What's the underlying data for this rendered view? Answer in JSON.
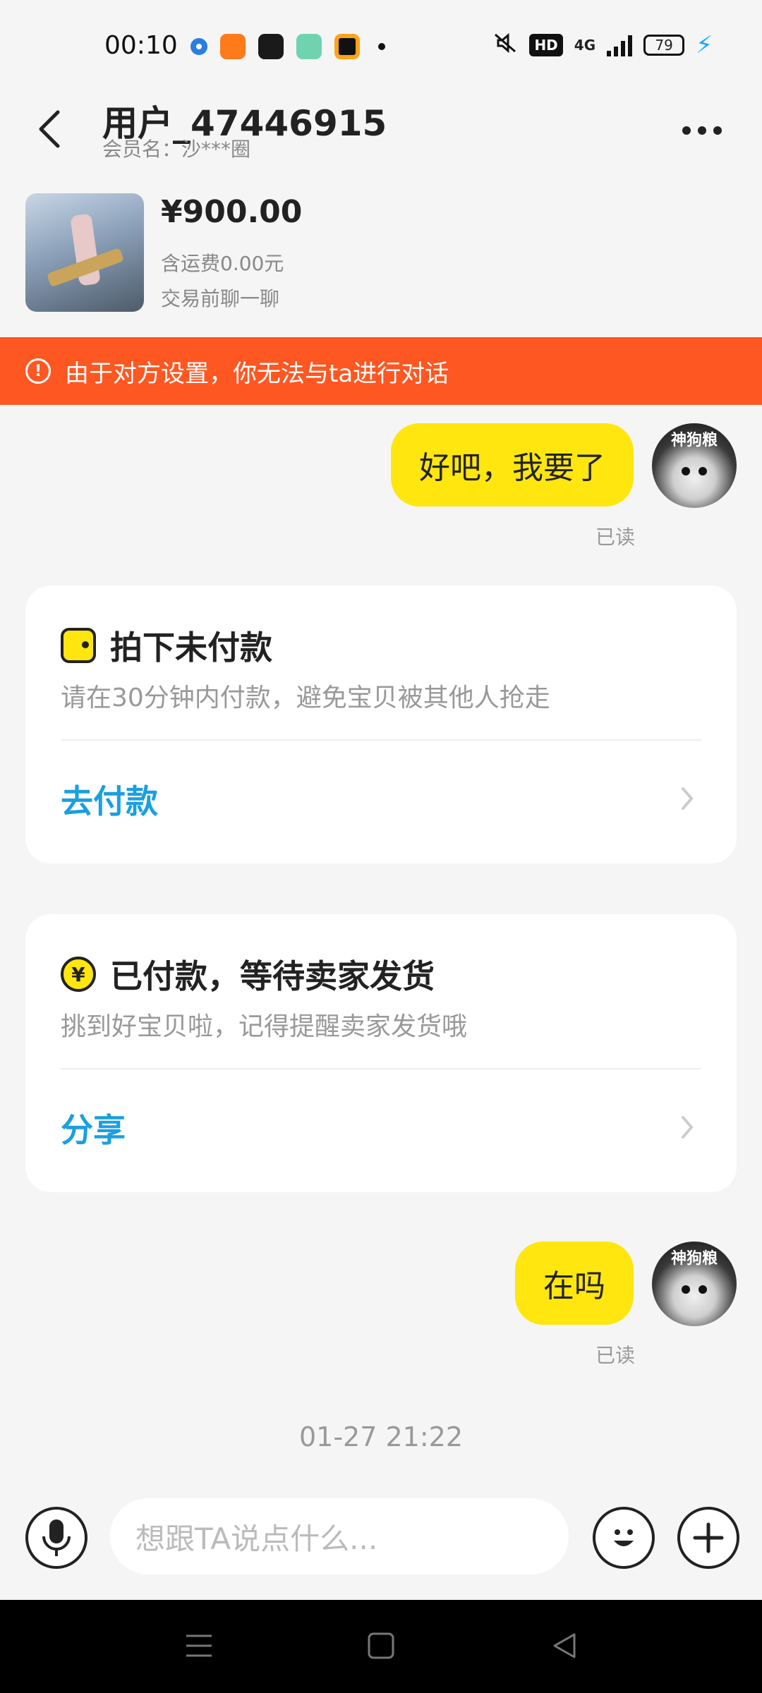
{
  "status_bar": {
    "time": "00:10",
    "network": "4G",
    "hd": "HD",
    "battery": "79"
  },
  "header": {
    "title": "用户_47446915",
    "subtitle": "会员名：沙***圈"
  },
  "product": {
    "price": "¥900.00",
    "shipping": "含运费0.00元",
    "chat_tip": "交易前聊一聊"
  },
  "warning": {
    "text": "由于对方设置，你无法与ta进行对话"
  },
  "messages": [
    {
      "text": "好吧，我要了",
      "status": "已读"
    },
    {
      "text": "在吗",
      "status": "已读"
    }
  ],
  "cards": [
    {
      "title": "拍下未付款",
      "desc": "请在30分钟内付款，避免宝贝被其他人抢走",
      "action": "去付款",
      "icon": "wallet-icon"
    },
    {
      "title": "已付款，等待卖家发货",
      "desc": "挑到好宝贝啦，记得提醒卖家发货哦",
      "action": "分享",
      "icon": "yen-icon"
    }
  ],
  "timestamp": "01-27 21:22",
  "input": {
    "placeholder": "想跟TA说点什么..."
  },
  "colors": {
    "bubble": "#ffe60f",
    "warning": "#ff5722",
    "link": "#1a9fe0",
    "background": "#f5f5f5"
  },
  "avatar_text": "神狗粮"
}
